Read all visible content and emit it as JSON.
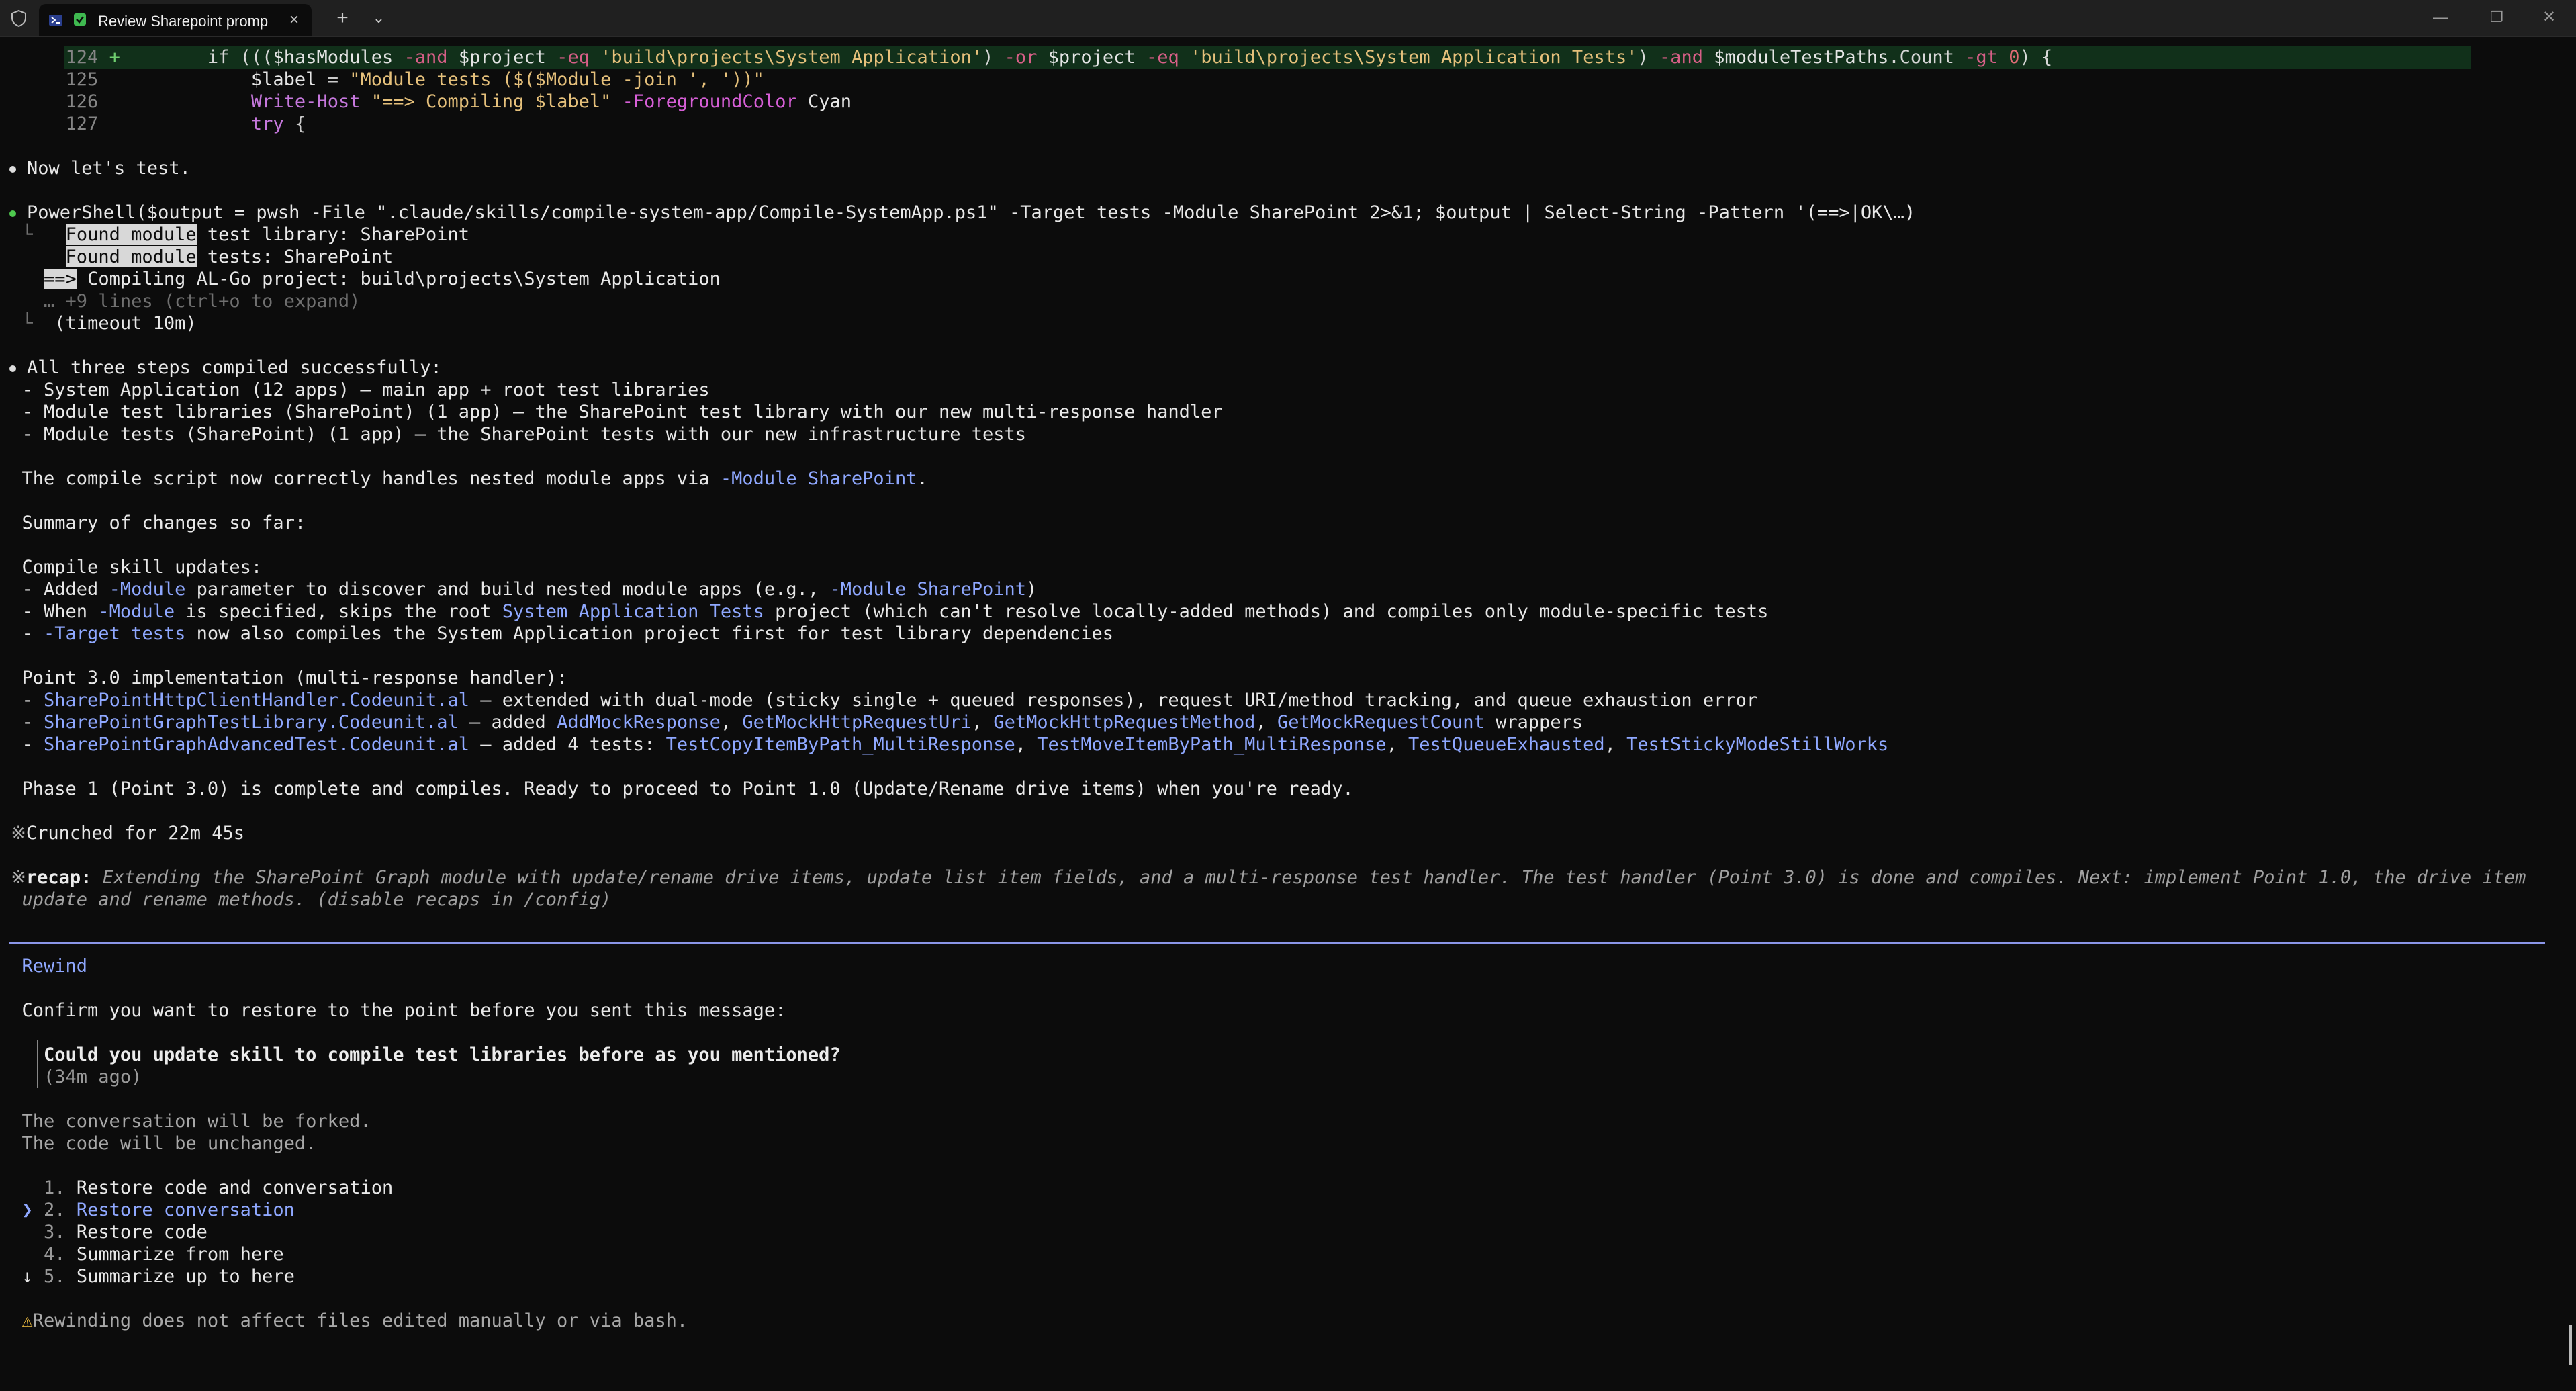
{
  "window": {
    "tab_title": "Review Sharepoint promp",
    "controls": {
      "minimize": "—",
      "maximize": "❐",
      "close": "✕"
    }
  },
  "diff": {
    "line124": {
      "num": "124",
      "sign": "+",
      "p1": "if (((",
      "v1": "$hasModules",
      "o1": " -and ",
      "v2": "$project",
      "o2": " -eq ",
      "s1": "'build\\projects\\System Application'",
      "p2": ") ",
      "o3": "-or",
      "p3": " ",
      "v3": "$project",
      "o4": " -eq ",
      "s2": "'build\\projects\\System Application Tests'",
      "p4": ") ",
      "o5": "-and",
      "p5": " ",
      "v4": "$moduleTestPaths",
      "p6": ".Count ",
      "o6": "-gt",
      "p7": " ",
      "n1": "0",
      "p8": ") {"
    },
    "line125": {
      "num": "125",
      "v": "$label",
      "p1": " = ",
      "s": "\"Module tests ($($Module -join ', '))\""
    },
    "line126": {
      "num": "126",
      "cmd": "Write-Host",
      "p1": " ",
      "s": "\"==> Compiling $label\"",
      "p2": " ",
      "param": "-ForegroundColor",
      "p3": " Cyan"
    },
    "line127": {
      "num": "127",
      "kw": "try",
      "p1": " {"
    }
  },
  "messages": {
    "lets_test": "Now let's test.",
    "tool_call": "PowerShell($output = pwsh -File \".claude/skills/compile-system-app/Compile-SystemApp.ps1\" -Target tests -Module SharePoint 2>&1; $output | Select-String -Pattern '(==>|OK\\…)",
    "tool_out": {
      "o1_sel": "Found module",
      "o1_rest": " test library: SharePoint",
      "o2_sel": "Found module",
      "o2_rest": " tests: SharePoint",
      "o3_sel": "==>",
      "o3_rest": " Compiling AL-Go project: build\\projects\\System Application",
      "more": "… +9 lines (ctrl+o to expand)",
      "timeout": "(timeout 10m)"
    },
    "summary": {
      "intro": "All three steps compiled successfully:",
      "s1": "- System Application (12 apps) — main app + root test libraries",
      "s2": "- Module test libraries (SharePoint) (1 app) — the SharePoint test library with our new multi-response handler",
      "s3": "- Module tests (SharePoint) (1 app) — the SharePoint tests with our new infrastructure tests",
      "compile_a": "The compile script now correctly handles nested module apps via ",
      "compile_b": "-Module SharePoint",
      "compile_c": ".",
      "so_far": "Summary of changes so far:",
      "skill_head": "Compile skill updates:",
      "k1a": "- Added ",
      "k1b": "-Module",
      "k1c": " parameter to discover and build nested module apps (e.g., ",
      "k1d": "-Module SharePoint",
      "k1e": ")",
      "k2a": "- When ",
      "k2b": "-Module",
      "k2c": " is specified, skips the root ",
      "k2d": "System Application Tests",
      "k2e": " project (which can't resolve locally-added methods) and compiles only module-specific tests",
      "k3a": "- ",
      "k3b": "-Target tests",
      "k3c": " now also compiles the System Application project first for test library dependencies",
      "point_head": "Point 3.0 implementation (multi-response handler):",
      "p1a": "- ",
      "p1b": "SharePointHttpClientHandler.Codeunit.al",
      "p1c": " — extended with dual-mode (sticky single + queued responses), request URI/method tracking, and queue exhaustion error",
      "p2a": "- ",
      "p2b": "SharePointGraphTestLibrary.Codeunit.al",
      "p2c": " — added ",
      "p2d": "AddMockResponse",
      "p2e": ", ",
      "p2f": "GetMockHttpRequestUri",
      "p2g": ", ",
      "p2h": "GetMockHttpRequestMethod",
      "p2i": ", ",
      "p2j": "GetMockRequestCount",
      "p2k": " wrappers",
      "p3a": "- ",
      "p3b": "SharePointGraphAdvancedTest.Codeunit.al",
      "p3c": " — added 4 tests: ",
      "p3d": "TestCopyItemByPath_MultiResponse",
      "p3e": ", ",
      "p3f": "TestMoveItemByPath_MultiResponse",
      "p3g": ", ",
      "p3h": "TestQueueExhausted",
      "p3i": ", ",
      "p3j": "TestStickyModeStillWorks",
      "phase": "Phase 1 (Point 3.0) is complete and compiles. Ready to proceed to Point 1.0 (Update/Rename drive items) when you're ready."
    },
    "crunched": "Crunched for 22m 45s",
    "recap_label": "recap:",
    "recap_l1": " Extending the SharePoint Graph module with update/rename drive items, update list item fields, and a multi-response test handler. The test handler (Point 3.0) is done and compiles. Next: implement Point 1.0, the drive item",
    "recap_l2": "update and rename methods. (disable recaps in /config)"
  },
  "rewind": {
    "title": "Rewind",
    "confirm": "Confirm you want to restore to the point before you sent this message:",
    "quoted_message": "Could you update skill to compile test libraries before as you mentioned?",
    "quoted_time": "(34m ago)",
    "fork_note": "The conversation will be forked.",
    "code_note": "The code will be unchanged.",
    "options": [
      {
        "num": "1.",
        "label": "Restore code and conversation"
      },
      {
        "num": "2.",
        "label": "Restore conversation"
      },
      {
        "num": "3.",
        "label": "Restore code"
      },
      {
        "num": "4.",
        "label": "Summarize from here"
      },
      {
        "num": "5.",
        "label": "Summarize up to here"
      }
    ],
    "selected_marker": "❯",
    "more_marker": "↓",
    "warning": "Rewinding does not affect files edited manually or via bash."
  }
}
